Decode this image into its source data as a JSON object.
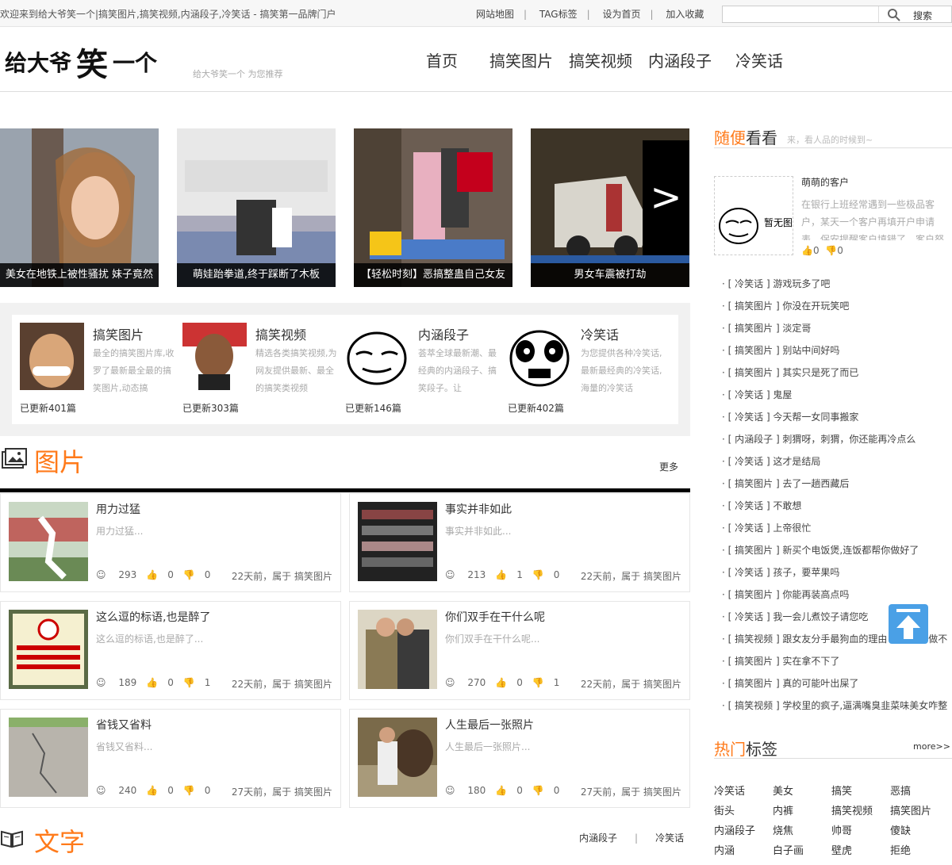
{
  "topbar": {
    "welcome": "欢迎来到给大爷笑一个|搞笑图片,搞笑视频,内涵段子,冷笑话 - 搞笑第一品牌门户",
    "links": [
      "网站地图",
      "TAG标签",
      "设为首页",
      "加入收藏"
    ],
    "search_value": "",
    "search_btn": "搜索"
  },
  "header": {
    "slogan": "给大爷笑一个 为您推荐",
    "nav": [
      "首页",
      "搞笑图片",
      "搞笑视频",
      "内涵段子",
      "冷笑话"
    ]
  },
  "slider": [
    {
      "caption": "美女在地铁上被性骚扰 妹子竟然"
    },
    {
      "caption": "萌娃跆拳道,终于踩断了木板"
    },
    {
      "caption": "【轻松时刻】恶搞整蛊自己女友"
    },
    {
      "caption": "男女车震被打劫"
    }
  ],
  "arrow": ">",
  "categories": [
    {
      "title": "搞笑图片",
      "desc": "最全的搞笑图片库,收罗了最新最全最的搞笑图片,动态搞",
      "updated": "已更新401篇"
    },
    {
      "title": "搞笑视频",
      "desc": "精选各类搞笑视频,为网友提供最新、最全的搞笑类视频",
      "updated": "已更新303篇"
    },
    {
      "title": "内涵段子",
      "desc": "荟萃全球最新潮、最经典的内涵段子、搞笑段子。让",
      "updated": "已更新146篇"
    },
    {
      "title": "冷笑话",
      "desc": "为您提供各种冷笑话,最新最经典的冷笑话,海量的冷笑话",
      "updated": "已更新402篇"
    }
  ],
  "pic_section": {
    "title": "图片",
    "more": "更多"
  },
  "pic_items": [
    {
      "title": "用力过猛",
      "desc": "用力过猛...",
      "views": "293",
      "likes": "0",
      "dislikes": "0",
      "info": "22天前，属于 搞笑图片"
    },
    {
      "title": "事实并非如此",
      "desc": "事实并非如此...",
      "views": "213",
      "likes": "1",
      "dislikes": "0",
      "info": "22天前，属于 搞笑图片"
    },
    {
      "title": "这么逗的标语,也是醉了",
      "desc": "这么逗的标语,也是醉了...",
      "views": "189",
      "likes": "0",
      "dislikes": "1",
      "info": "22天前，属于 搞笑图片"
    },
    {
      "title": "你们双手在干什么呢",
      "desc": "你们双手在干什么呢...",
      "views": "270",
      "likes": "0",
      "dislikes": "1",
      "info": "22天前，属于 搞笑图片"
    },
    {
      "title": "省钱又省料",
      "desc": "省钱又省料...",
      "views": "240",
      "likes": "0",
      "dislikes": "0",
      "info": "27天前，属于 搞笑图片"
    },
    {
      "title": "人生最后一张照片",
      "desc": "人生最后一张照片...",
      "views": "180",
      "likes": "0",
      "dislikes": "0",
      "info": "27天前，属于 搞笑图片"
    }
  ],
  "text_section": {
    "title": "文字",
    "links": [
      "内涵段子",
      "冷笑话"
    ]
  },
  "sidebar": {
    "h1_accent": "随便",
    "h1_rest": "看看",
    "h1_sub": "来，看人品的时候到~",
    "featured": {
      "title": "萌萌的客户",
      "desc": "在银行上班经常遇到一些极品客户，某天一个客户再填开户申请表，保安提醒客户填错了，客户怒",
      "likes": "0",
      "dislikes": "0",
      "img_text": "暂无图片"
    },
    "list": [
      "· [ 冷笑话 ] 游戏玩多了吧",
      "· [ 搞笑图片 ] 你没在开玩笑吧",
      "· [ 搞笑图片 ] 淡定哥",
      "· [ 搞笑图片 ] 别站中间好吗",
      "· [ 搞笑图片 ] 其实只是死了而已",
      "· [ 冷笑话 ] 鬼屋",
      "· [ 冷笑话 ] 今天帮一女同事搬家",
      "· [ 内涵段子 ] 刺猬呀，刺猬，你还能再冷点么",
      "· [ 冷笑话 ] 这才是结局",
      "· [ 搞笑图片 ] 去了一趟西藏后",
      "· [ 冷笑话 ] 不敢想",
      "· [ 冷笑话 ] 上帝很忙",
      "· [ 搞笑图片 ] 新买个电饭煲,连饭都帮你做好了",
      "· [ 冷笑话 ] 孩子，要苹果吗",
      "· [ 搞笑图片 ] 你能再装高点吗",
      "· [ 冷笑话 ] 我一会儿煮饺子请您吃",
      "· [ 搞笑视频 ] 跟女友分手最狗血的理由 分手后的做不",
      "· [ 搞笑图片 ] 实在拿不下了",
      "· [ 搞笑图片 ] 真的可能叶出屎了",
      "· [ 搞笑视频 ] 学校里的疯子,逼满嘴臭韭菜味美女咋整"
    ],
    "h2_accent": "热门",
    "h2_rest": "标签",
    "more": "more>>",
    "tags": [
      "冷笑话",
      "美女",
      "搞笑",
      "恶搞",
      "街头",
      "内裤",
      "搞笑视频",
      "搞笑图片",
      "内涵段子",
      "烧焦",
      "帅哥",
      "傻缺",
      "内涵",
      "白子画",
      "壁虎",
      "拒绝"
    ]
  }
}
